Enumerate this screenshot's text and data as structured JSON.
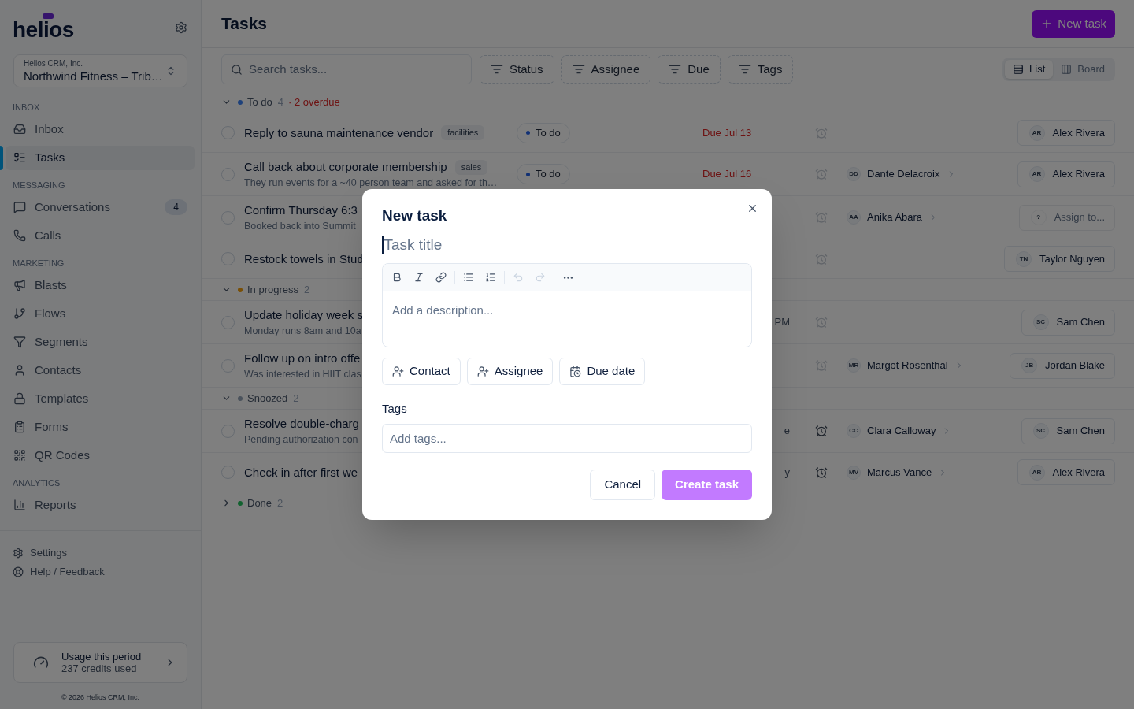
{
  "sidebar": {
    "logo": "helios",
    "workspace": {
      "org": "Helios CRM, Inc.",
      "name": "Northwind Fitness – Trib…"
    },
    "sections": [
      {
        "heading": "INBOX",
        "items": [
          {
            "label": "Inbox",
            "selected": false
          },
          {
            "label": "Tasks",
            "selected": true
          }
        ]
      },
      {
        "heading": "MESSAGING",
        "items": [
          {
            "label": "Conversations",
            "selected": false,
            "badge": "4"
          },
          {
            "label": "Calls",
            "selected": false
          }
        ]
      },
      {
        "heading": "MARKETING",
        "items": [
          {
            "label": "Blasts",
            "selected": false
          },
          {
            "label": "Flows",
            "selected": false
          },
          {
            "label": "Segments",
            "selected": false
          },
          {
            "label": "Contacts",
            "selected": false
          },
          {
            "label": "Templates",
            "selected": false
          },
          {
            "label": "Forms",
            "selected": false
          },
          {
            "label": "QR Codes",
            "selected": false
          }
        ]
      },
      {
        "heading": "ANALYTICS",
        "items": [
          {
            "label": "Reports",
            "selected": false
          }
        ]
      }
    ],
    "footer_links": [
      "Settings",
      "Help / Feedback"
    ],
    "usage": {
      "title": "Usage this period",
      "detail": "237 credits used"
    },
    "copyright": "© 2026 Helios CRM, Inc."
  },
  "header": {
    "title": "Tasks",
    "new_button": "New task"
  },
  "toolbar": {
    "search": {
      "placeholder": "Search tasks..."
    },
    "filters": [
      "Status",
      "Assignee",
      "Due",
      "Tags"
    ],
    "views": [
      {
        "label": "List",
        "selected": true
      },
      {
        "label": "Board",
        "selected": false
      }
    ]
  },
  "groups": [
    {
      "name": "To do",
      "count": "4",
      "note": "· 2 overdue",
      "color": "#1e417b",
      "expanded": true,
      "rows": [
        {
          "title": "Reply to sauna maintenance vendor",
          "tag": "facilities",
          "checked": false,
          "status": "To do",
          "due": {
            "text": "Due Jul 13",
            "overdue": true,
            "clipped": false
          },
          "snoozed": false,
          "assignee": {
            "initials": "AR",
            "name": "Alex Rivera",
            "assigned": true
          }
        },
        {
          "title": "Call back about corporate membership",
          "tag": "sales",
          "subtitle": "They run events for a ~40 person team and asked for th…",
          "checked": false,
          "status": "To do",
          "due": {
            "text": "Due Jul 16",
            "overdue": true,
            "clipped": false
          },
          "snoozed": false,
          "contact": {
            "initials": "DD",
            "name": "Dante Delacroix"
          },
          "assignee": {
            "initials": "AR",
            "name": "Alex Rivera",
            "assigned": true
          }
        },
        {
          "title": "Confirm Thursday 6:3",
          "subtitle": "Booked back into Summit",
          "checked": false,
          "snoozed": false,
          "contact": {
            "initials": "AA",
            "name": "Anika Abara"
          },
          "assignee": {
            "initials": "?",
            "name": "Assign to...",
            "assigned": false
          }
        },
        {
          "title": "Restock towels in Stud",
          "checked": false,
          "snoozed": false,
          "assignee": {
            "initials": "TN",
            "name": "Taylor Nguyen",
            "assigned": true
          }
        }
      ]
    },
    {
      "name": "In progress",
      "count": "2",
      "color": "#7a4f05",
      "expanded": true,
      "rows": [
        {
          "title": "Update holiday week s",
          "subtitle": "Monday runs 8am and 10a",
          "checked": false,
          "due": {
            "text": "PM",
            "overdue": false,
            "clipped": true
          },
          "snoozed": false,
          "assignee": {
            "initials": "SC",
            "name": "Sam Chen",
            "assigned": true
          }
        },
        {
          "title": "Follow up on intro offe",
          "subtitle": "Was interested in HIIT clas",
          "checked": false,
          "snoozed": false,
          "contact": {
            "initials": "MR",
            "name": "Margot Rosenthal"
          },
          "assignee": {
            "initials": "JB",
            "name": "Jordan Blake",
            "assigned": true
          }
        }
      ]
    },
    {
      "name": "Snoozed",
      "count": "2",
      "color": "#4a525c",
      "expanded": true,
      "rows": [
        {
          "title": "Resolve double-charg",
          "subtitle": "Pending authorization con",
          "checked": false,
          "due": {
            "text": "e",
            "overdue": false,
            "clipped": true
          },
          "snoozed": true,
          "contact": {
            "initials": "CC",
            "name": "Clara Calloway"
          },
          "assignee": {
            "initials": "SC",
            "name": "Sam Chen",
            "assigned": true
          }
        },
        {
          "title": "Check in after first we",
          "checked": false,
          "due": {
            "text": "y",
            "overdue": false,
            "clipped": true
          },
          "snoozed": true,
          "contact": {
            "initials": "MV",
            "name": "Marcus Vance"
          },
          "assignee": {
            "initials": "AR",
            "name": "Alex Rivera",
            "assigned": true
          }
        }
      ]
    },
    {
      "name": "Done",
      "count": "2",
      "color": "#11622f",
      "expanded": false
    }
  ],
  "modal": {
    "title": "New task",
    "title_field": {
      "placeholder": "Task title",
      "focused": true
    },
    "description": {
      "placeholder": "Add a description...",
      "undo_disabled": true,
      "redo_disabled": true
    },
    "attribute_buttons": [
      {
        "kind": "person",
        "label": "Contact"
      },
      {
        "kind": "person",
        "label": "Assignee"
      },
      {
        "kind": "date",
        "label": "Due date"
      }
    ],
    "tags_label": "Tags",
    "tags_field": {
      "placeholder": "Add tags..."
    },
    "cancel": "Cancel",
    "create": {
      "label": "Create task",
      "disabled": true
    }
  }
}
